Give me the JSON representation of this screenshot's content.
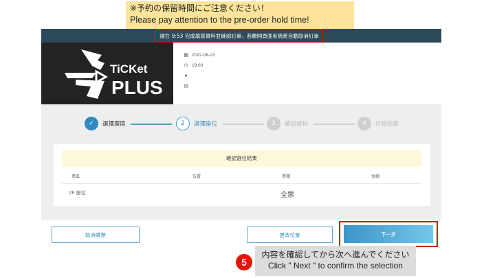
{
  "annotation_top": {
    "line_jp": "※予約の保留時間にご注意ください！",
    "line_en": "Please pay attention to the pre-order hold time!"
  },
  "timer_banner": "請在 9:53 完成填寫資料並確認訂單，若離開頁面系統將自動取消訂單",
  "logo": {
    "line1": "TiCKet",
    "line2": "PLUS"
  },
  "event": {
    "date": "2022-08-13",
    "time": "19:00",
    "location": "",
    "venue": ""
  },
  "icons": {
    "date": "calendar-icon",
    "time": "clock-icon",
    "location": "pin-icon",
    "venue": "building-icon"
  },
  "steps": [
    {
      "num": "✓",
      "label": "選擇票區",
      "state": "done"
    },
    {
      "num": "2",
      "label": "選擇座位",
      "state": "active"
    },
    {
      "num": "3",
      "label": "確認資料",
      "state": "todo"
    },
    {
      "num": "4",
      "label": "付款結帳",
      "state": "todo"
    }
  ],
  "confirm": {
    "title": "確認選位結果",
    "headers": [
      "票區",
      "位置",
      "票種",
      "金額"
    ],
    "row": {
      "area": "2F 座位",
      "position": "",
      "ticket_type": "全票",
      "amount": ""
    }
  },
  "buttons": {
    "cancel": "取消購票",
    "change_seat": "更改位置",
    "next": "下一步"
  },
  "annotation_bottom": {
    "step_number": "5",
    "line_jp": "内容を確認してから次へ進んでください",
    "line_en": "Click \" Next \" to confirm the selection"
  },
  "colors": {
    "accent": "#2e8ac0",
    "highlight": "#e00000",
    "top_bar": "#2c4a5a"
  }
}
